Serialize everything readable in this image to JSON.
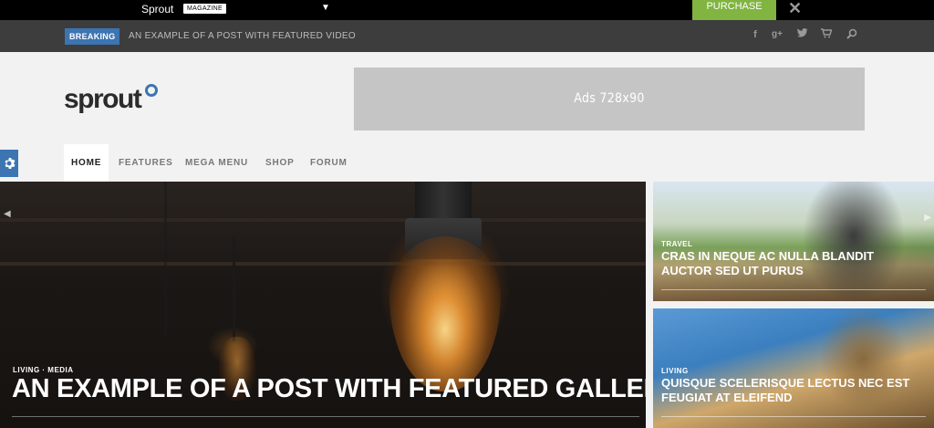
{
  "demo_bar": {
    "brand": "Sprout",
    "tag": "MAGAZINE",
    "purchase": "PURCHASE",
    "close": "✕",
    "caret": "▼",
    "accent": "#81b441"
  },
  "breaking": {
    "label": "BREAKING",
    "text": "AN EXAMPLE OF A POST WITH FEATURED VIDEO",
    "accent": "#3d74b2",
    "social": [
      {
        "icon": "facebook-icon",
        "glyph": "f"
      },
      {
        "icon": "google-plus-icon",
        "glyph": "g+"
      },
      {
        "icon": "twitter-icon",
        "glyph": "🐦"
      },
      {
        "icon": "cart-icon",
        "glyph": "🛒"
      },
      {
        "icon": "search-icon",
        "glyph": "⚲"
      }
    ]
  },
  "header": {
    "logo": "sprout",
    "ad": "Ads 728x90"
  },
  "nav": {
    "items": [
      "HOME",
      "FEATURES",
      "MEGA MENU",
      "SHOP",
      "FORUM"
    ],
    "active": "HOME"
  },
  "hero": {
    "categories": "LIVING · MEDIA",
    "title": "AN EXAMPLE OF A POST WITH FEATURED GALLERY"
  },
  "side_posts": [
    {
      "category": "TRAVEL",
      "title": "CRAS IN NEQUE AC NULLA BLANDIT AUCTOR SED UT PURUS"
    },
    {
      "category": "LIVING",
      "title": "QUISQUE SCELERISQUE LECTUS NEC EST FEUGIAT AT ELEIFEND"
    }
  ]
}
